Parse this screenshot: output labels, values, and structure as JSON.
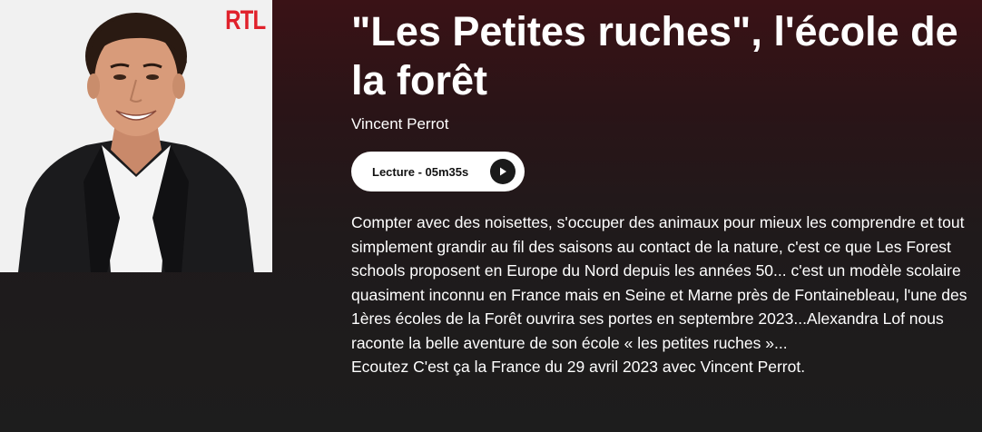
{
  "cover": {
    "logo": "RTL",
    "icon": "host-portrait"
  },
  "episode": {
    "title": "\"Les Petites ruches\", l'école de la forêt",
    "author": "Vincent Perrot",
    "play_label": "Lecture - 05m35s",
    "play_icon": "play-icon",
    "description": "Compter avec des noisettes, s'occuper des animaux pour mieux les comprendre et tout simplement grandir au fil des saisons au contact de la nature, c'est ce que Les Forest schools proposent en Europe du Nord depuis les années 50... c'est un modèle scolaire quasiment inconnu en France mais en Seine et Marne près de Fontainebleau, l'une des 1ères écoles de la Forêt ouvrira ses portes en septembre 2023...Alexandra Lof nous raconte la belle aventure de son école « les petites ruches »...",
    "description_footer": "Ecoutez C'est ça la France du 29 avril 2023 avec Vincent Perrot."
  },
  "colors": {
    "logo_red": "#e0212b",
    "background_top": "#3a1216",
    "background_bottom": "#1d1d1d",
    "button_bg": "#ffffff",
    "button_icon_bg": "#1a1a1a"
  }
}
